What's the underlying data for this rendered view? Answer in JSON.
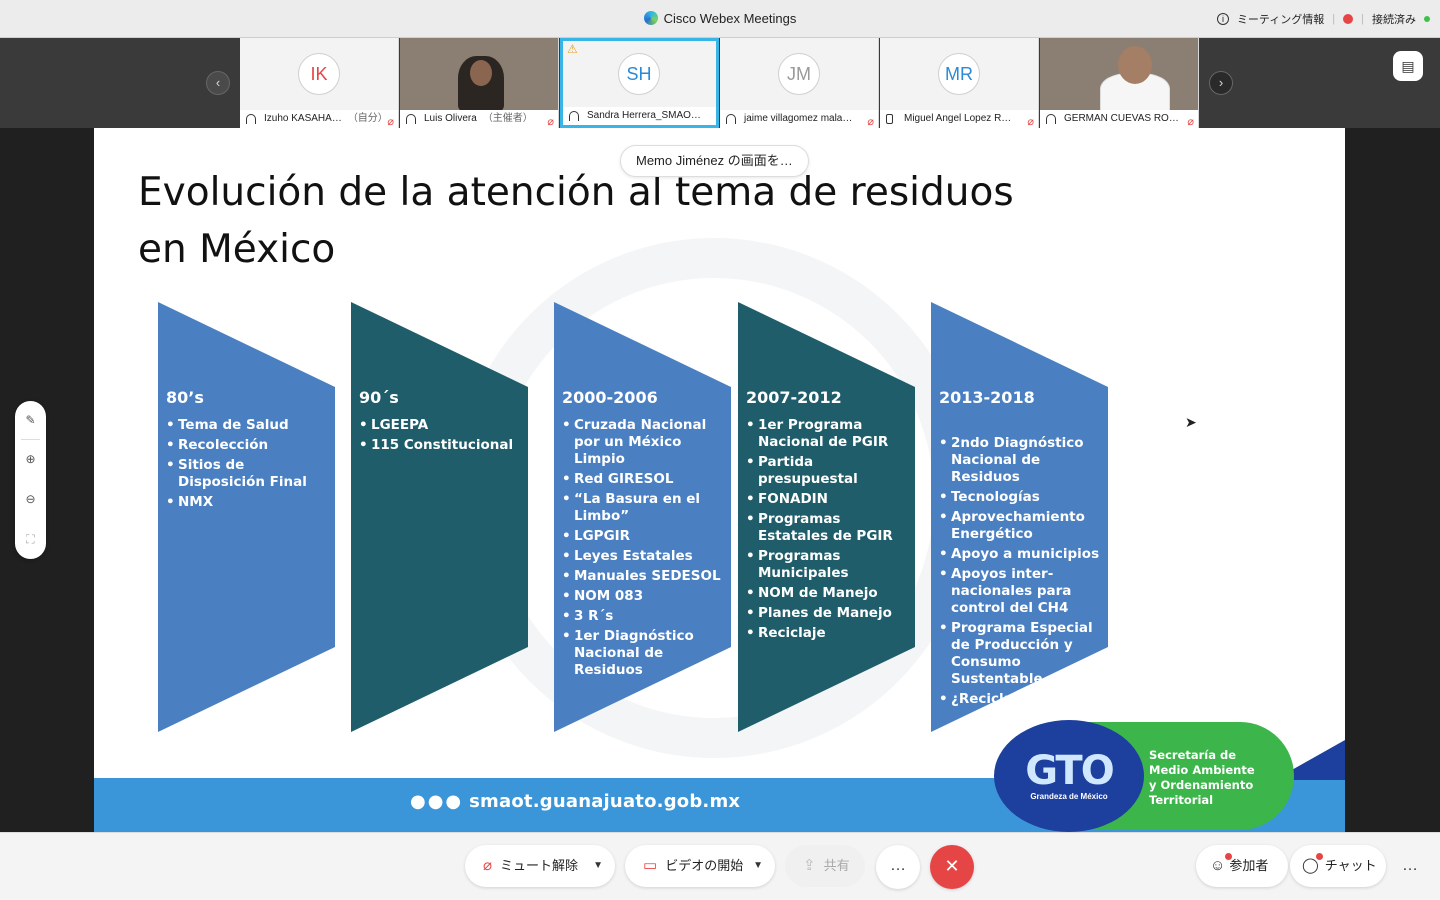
{
  "window": {
    "title": "Cisco Webex Meetings",
    "meeting_info": "ミーティング情報",
    "connection": "接続済み"
  },
  "participants": [
    {
      "initials": "IK",
      "name": "Izuho KASAHA…",
      "tag": "（自分）",
      "initials_color": "#e64545"
    },
    {
      "initials": "",
      "name": "Luis Olivera",
      "tag": "（主催者）"
    },
    {
      "initials": "SH",
      "name": "Sandra Herrera_SMAO…",
      "tag": "",
      "initials_color": "#2a8ad6"
    },
    {
      "initials": "JM",
      "name": "jaime villagomez mala…",
      "tag": "",
      "initials_color": "#999999"
    },
    {
      "initials": "MR",
      "name": "Miguel Angel Lopez R…",
      "tag": "",
      "initials_color": "#2a8ad6"
    },
    {
      "initials": "",
      "name": "GERMAN CUEVAS RO…",
      "tag": ""
    }
  ],
  "share": {
    "label": "Memo Jiménez の画面を…"
  },
  "slide": {
    "title_line1": "Evolución de la atención al tema de residuos",
    "title_line2": "en México",
    "columns": [
      {
        "heading": "80’s",
        "items": [
          "Tema de Salud",
          "Recolección",
          "Sitios de Disposición Final",
          "NMX"
        ],
        "color": "#4a7fc1"
      },
      {
        "heading": "90´s",
        "items": [
          "LGEEPA",
          "115 Constitucional"
        ],
        "color": "#1f5d6a"
      },
      {
        "heading": "2000-2006",
        "items": [
          "Cruzada Nacional por un México Limpio",
          "Red GIRESOL",
          "“La Basura en el Limbo”",
          "LGPGIR",
          "Leyes Estatales",
          "Manuales SEDESOL",
          "NOM 083",
          "3 R´s",
          "1er Diagnóstico Nacional de Residuos"
        ],
        "color": "#4a7fc1"
      },
      {
        "heading": "2007-2012",
        "items": [
          "1er Programa Nacional de PGIR",
          "Partida presupuestal",
          "FONADIN",
          "Programas Estatales de PGIR",
          "Programas Municipales",
          "NOM de Manejo",
          "Planes de Manejo",
          "Reciclaje"
        ],
        "color": "#1f5d6a"
      },
      {
        "heading": "2013-2018",
        "items": [
          "2ndo Diagnóstico Nacional de Residuos",
          "Tecnologías",
          "Aprovechamiento Energético",
          "Apoyo a municipios",
          "Apoyos inter-nacionales para control del CH4",
          "Programa Especial de Producción y Consumo Sustentable",
          "¿Reciclaje?"
        ],
        "color": "#4a7fc1"
      }
    ],
    "url": "smaot.guanajuato.gob.mx",
    "url_dots": "●●●",
    "logo": {
      "mark": "GTO",
      "tagline": "Grandeza de México",
      "org_line1": "Secretaría de",
      "org_line2": "Medio Ambiente",
      "org_line3": "y Ordenamiento",
      "org_line4": "Territorial"
    }
  },
  "controls": {
    "unmute": "ミュート解除",
    "start_video": "ビデオの開始",
    "share": "共有",
    "more": "…",
    "participants": "参加者",
    "chat": "チャット"
  }
}
